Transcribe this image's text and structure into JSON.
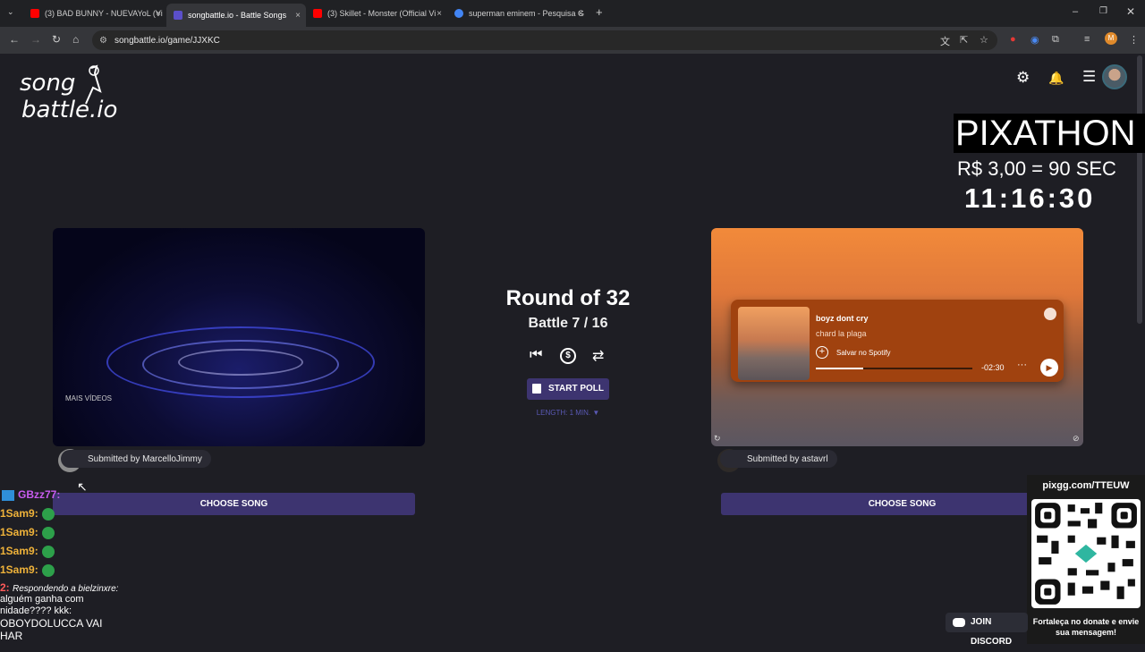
{
  "browser": {
    "tabs": [
      {
        "label": "(3) BAD BUNNY - NUEVAYoL (Vi",
        "fav": "#ff0000"
      },
      {
        "label": "songbattle.io - Battle Songs",
        "fav": "#5b4fc9"
      },
      {
        "label": "(3) Skillet - Monster (Official Vi",
        "fav": "#ff0000"
      },
      {
        "label": "superman eminem - Pesquisa G",
        "fav": "#4285f4"
      }
    ],
    "url": "songbattle.io/game/JJXKC",
    "new_tab": "+",
    "close": "×"
  },
  "header": {
    "logo_line1": "song",
    "logo_line2": "battle.io",
    "gear_icon": "⚙",
    "bell_icon": "🔔",
    "menu_icon": "☰"
  },
  "overlay": {
    "pixathon": "PIXATHON",
    "rate": "R$ 3,00 = 90 SEC",
    "timer": "11:16:30"
  },
  "left_song": {
    "video_label": "MAIS VÍDEOS",
    "submitted": "Submitted by MarcelloJimmy",
    "choose": "CHOOSE SONG"
  },
  "right_song": {
    "track_title": "boyz dont cry",
    "track_artist": "chard la plaga",
    "save_label": "Salvar no Spotify",
    "time": "-02:30",
    "progress": 0.3,
    "more": "···",
    "play": "▶",
    "submitted": "Submitted by astavrl",
    "choose": "CHOOSE SONG"
  },
  "center": {
    "round": "Round of 32",
    "battle": "Battle 7 / 16",
    "prev_icon": "⏮",
    "money_icon": "$",
    "shuffle_icon": "⇄",
    "poll": "START POLL",
    "length": "LENGTH: 1 MIN. ▼"
  },
  "chat": {
    "line1": "GBzz77:",
    "line2": "1Sam9:",
    "line3": "1Sam9:",
    "line4": "1Sam9:",
    "line5": "1Sam9:",
    "line6_user": "2:",
    "line6_text": "Respondendo a bielzinxre:",
    "line7": "alguém ganha com",
    "line8": "nidade???? kkk:",
    "line9": "OBOYDOLUCCA VAI",
    "line10": "HAR"
  },
  "donate": {
    "url": "pixgg.com/TTEUW",
    "message": "Fortaleça no donate e envie sua mensagem!",
    "discord": "JOIN DISCORD"
  }
}
